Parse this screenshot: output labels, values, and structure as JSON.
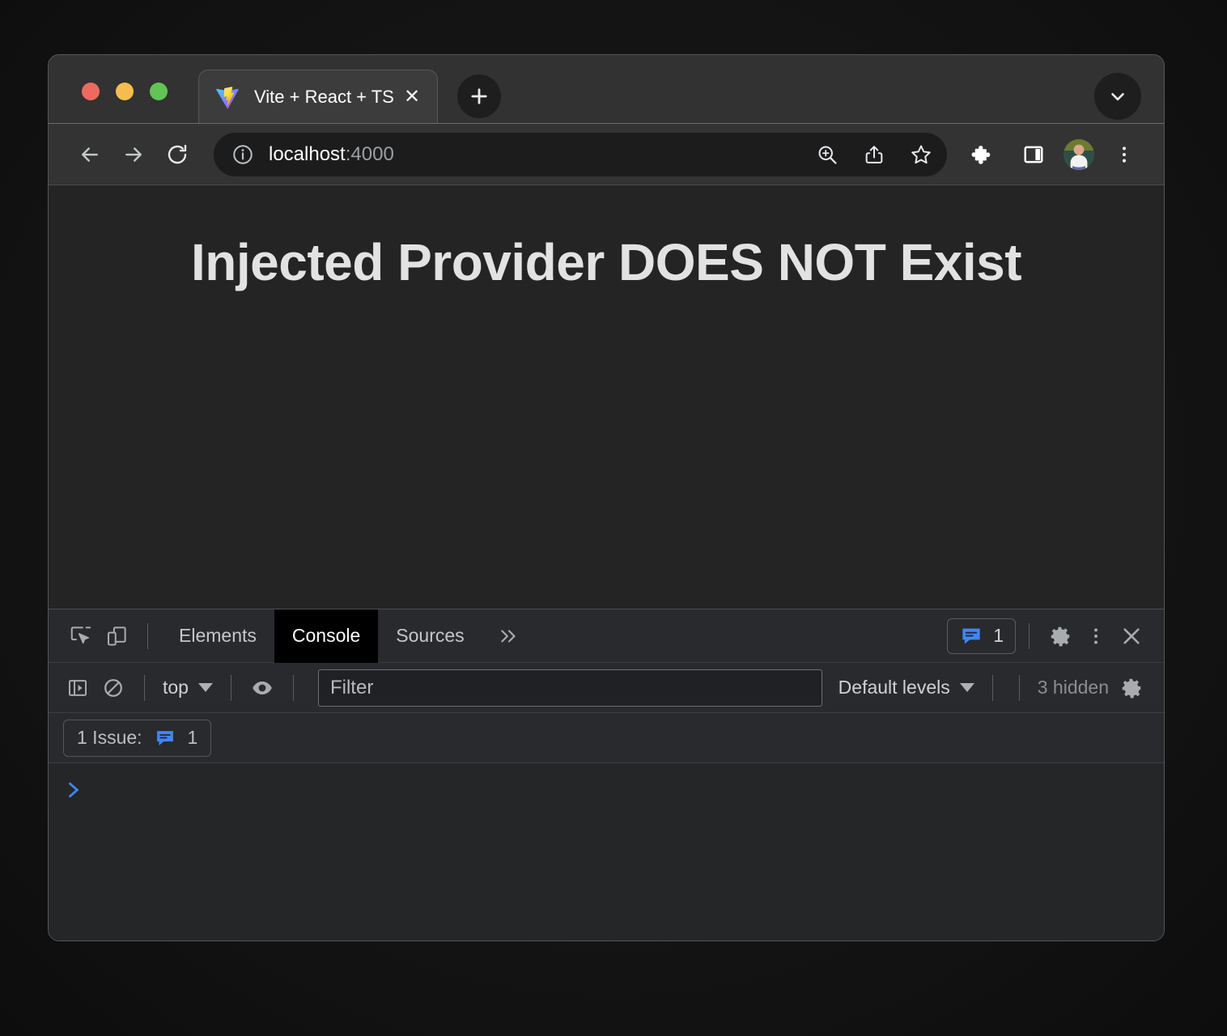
{
  "window": {
    "traffic_lights": [
      "close",
      "minimize",
      "zoom"
    ],
    "colors": {
      "close": "#ee6a5f",
      "minimize": "#f5bd4f",
      "zoom": "#61c454",
      "accent_blue": "#4285f4",
      "page_bg": "#242424"
    }
  },
  "tabstrip": {
    "tabs": [
      {
        "title": "Vite + React + TS",
        "favicon": "vite-logo-icon",
        "active": true
      }
    ],
    "new_tab_label": "+",
    "close_label": "✕",
    "tab_search_icon": "chevron-down-icon"
  },
  "toolbar": {
    "back_icon": "back-arrow-icon",
    "forward_icon": "forward-arrow-icon",
    "reload_icon": "reload-icon",
    "site_info_icon": "info-circle-icon",
    "url_host": "localhost",
    "url_rest": ":4000",
    "url_full": "localhost:4000",
    "zoom_icon": "zoom-in-icon",
    "share_icon": "share-icon",
    "bookmark_icon": "star-icon",
    "extensions_icon": "puzzle-piece-icon",
    "side_panel_icon": "side-panel-icon",
    "avatar_icon": "profile-avatar",
    "menu_icon": "three-dot-menu-icon"
  },
  "page": {
    "heading": "Injected Provider DOES NOT Exist"
  },
  "devtools": {
    "inspect_icon": "inspect-element-icon",
    "device_toolbar_icon": "device-toolbar-icon",
    "tabs": [
      {
        "label": "Elements",
        "active": false
      },
      {
        "label": "Console",
        "active": true
      },
      {
        "label": "Sources",
        "active": false
      }
    ],
    "more_tabs_icon": "chevron-double-right-icon",
    "issues_chip": {
      "icon": "issue-speech-bubble-icon",
      "count": "1"
    },
    "settings_icon": "gear-icon",
    "more_options_icon": "three-dot-menu-icon",
    "close_icon": "close-x-icon",
    "console_toolbar": {
      "sidebar_icon": "console-sidebar-icon",
      "clear_icon": "clear-console-icon",
      "context_label": "top",
      "live_expression_icon": "eye-icon",
      "filter_placeholder": "Filter",
      "filter_value": "",
      "levels_label": "Default levels",
      "hidden_label": "3 hidden",
      "console_settings_icon": "gear-icon"
    },
    "issue_bar": {
      "label": "1 Issue:",
      "icon": "issue-speech-bubble-icon",
      "count": "1"
    },
    "prompt": {
      "caret_icon": "prompt-chevron-icon",
      "value": ""
    }
  }
}
